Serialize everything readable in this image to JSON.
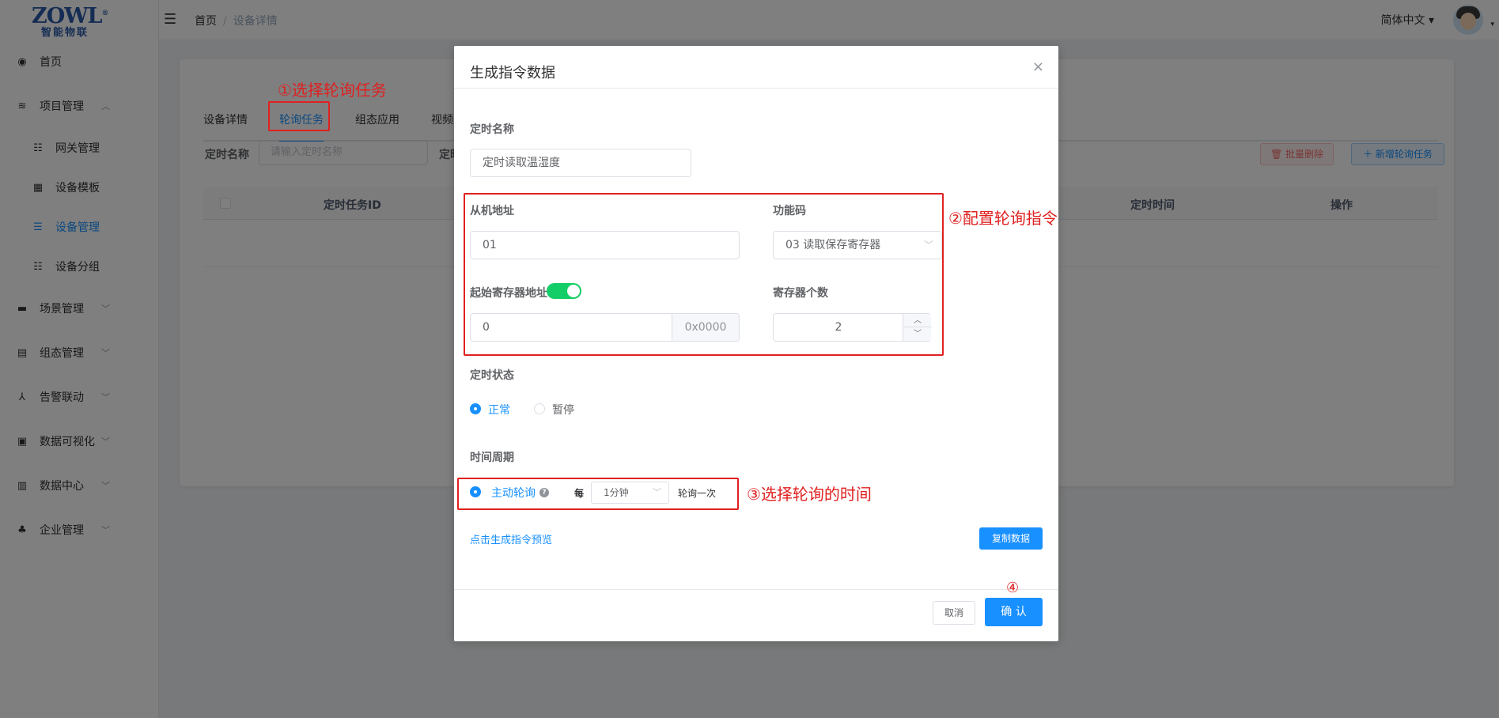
{
  "logo": {
    "mark": "ZOWL",
    "registered": "®",
    "sub": "智能物联"
  },
  "sidebar": {
    "items": [
      {
        "label": "首页",
        "icon": "dashboard-icon",
        "glyph": "◉"
      },
      {
        "label": "项目管理",
        "icon": "layers-icon",
        "glyph": "≋",
        "chevron": "︿"
      },
      {
        "label": "网关管理",
        "icon": "tree-table-icon",
        "glyph": "☷"
      },
      {
        "label": "设备模板",
        "icon": "grid-icon",
        "glyph": "▦"
      },
      {
        "label": "设备管理",
        "icon": "list-icon",
        "glyph": "☰"
      },
      {
        "label": "设备分组",
        "icon": "tree-icon",
        "glyph": "☷"
      },
      {
        "label": "场景管理",
        "icon": "clapper-icon",
        "glyph": "▬",
        "chevron": "﹀"
      },
      {
        "label": "组态管理",
        "icon": "component-icon",
        "glyph": "▤",
        "chevron": "﹀"
      },
      {
        "label": "告警联动",
        "icon": "link-icon",
        "glyph": "⅄",
        "chevron": "﹀"
      },
      {
        "label": "数据可视化",
        "icon": "monitor-icon",
        "glyph": "▣",
        "chevron": "﹀"
      },
      {
        "label": "数据中心",
        "icon": "chart-icon",
        "glyph": "▥",
        "chevron": "﹀"
      },
      {
        "label": "企业管理",
        "icon": "user-icon",
        "glyph": "♣",
        "chevron": "﹀"
      }
    ]
  },
  "topbar": {
    "hamburger": "☰",
    "breadcrumb": {
      "home": "首页",
      "sep": "/",
      "current": "设备详情"
    },
    "language": "简体中文 ▾",
    "avatar_caret": "▾"
  },
  "page": {
    "tabs": [
      "设备详情",
      "轮询任务",
      "组态应用",
      "视频"
    ],
    "filter_label": "定时名称",
    "filter_placeholder": "请输入定时名称",
    "filter_label2": "定时",
    "batch_delete": "🗑 批量删除",
    "add_task": "＋ 新增轮询任务",
    "table_headers": [
      "定时任务ID",
      "定时时间",
      "操作"
    ]
  },
  "dialog": {
    "title": "生成指令数据",
    "close": "×",
    "timer_name_label": "定时名称",
    "timer_name_value": "定时读取温湿度",
    "slave_addr_label": "从机地址",
    "slave_addr_value": "01",
    "function_code_label": "功能码",
    "function_code_value": "03 读取保存寄存器",
    "start_reg_label": "起始寄存器地址",
    "start_reg_value": "0",
    "start_reg_hex": "0x0000",
    "reg_count_label": "寄存器个数",
    "reg_count_value": "2",
    "stepper_up": "︿",
    "stepper_down": "﹀",
    "select_arrow": "﹀",
    "status_label": "定时状态",
    "status_options": [
      "正常",
      "暂停"
    ],
    "period_label": "时间周期",
    "active_poll_label": "主动轮询",
    "help_glyph": "?",
    "every_label": "每",
    "interval_value": "1分钟",
    "poll_once_label": "轮询一次",
    "preview_link": "点击生成指令预览",
    "copy_button": "复制数据",
    "cancel_button": "取消",
    "confirm_button": "确 认"
  },
  "annotations": {
    "step1": "①选择轮询任务",
    "step2": "②配置轮询指令",
    "step3": "③选择轮询的时间",
    "step4": "④"
  },
  "colors": {
    "primary": "#1890ff",
    "switch_on": "#13ce66",
    "annotation_red": "#e02020"
  }
}
